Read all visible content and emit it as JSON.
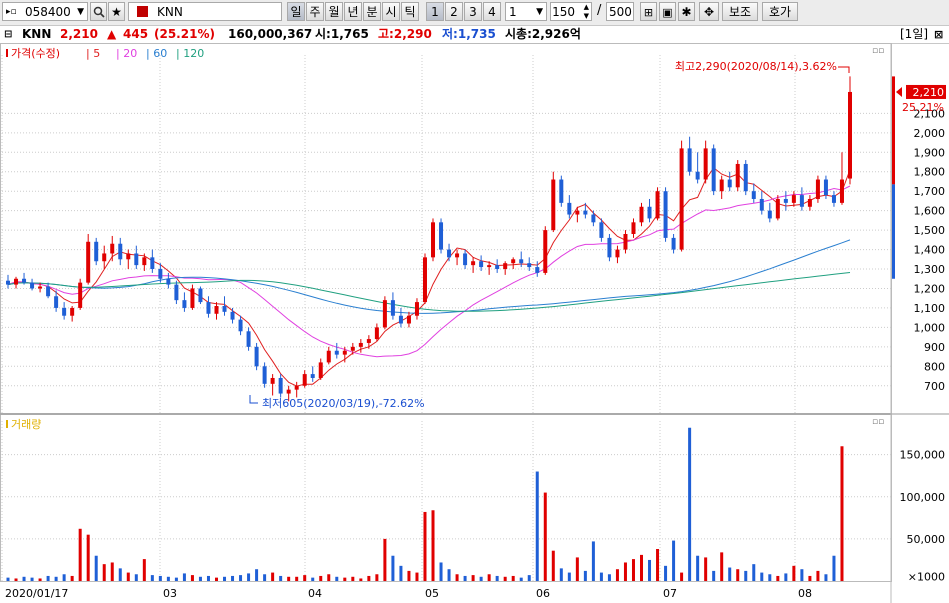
{
  "toolbar": {
    "code": "058400",
    "name": "KNN",
    "periods": [
      "일",
      "주",
      "월",
      "년",
      "분",
      "시",
      "틱"
    ],
    "numbers": [
      "1",
      "2",
      "3",
      "4"
    ],
    "unit_value": "1",
    "count_value": "150",
    "slash": "/",
    "total_value": "500",
    "aux_button": "보조",
    "quote_button": "호가"
  },
  "info": {
    "name": "KNN",
    "price": "2,210",
    "change_arrow": "▲",
    "change": "445",
    "change_pct": "(25.21%)",
    "volume": "160,000,367",
    "open": "시:1,765",
    "high": "고:2,290",
    "low": "저:1,735",
    "market_cap": "시총:2,926억",
    "period_label": "[1일]"
  },
  "colors": {
    "up": "#e00000",
    "down": "#1f5fd6",
    "ma5": "#e02020",
    "ma20": "#e040e0",
    "ma60": "#2a7fd0",
    "ma120": "#20a080"
  },
  "chart_data": {
    "type": "candlestick",
    "legend": {
      "price": "가격(수정)",
      "ma": [
        "5",
        "20",
        "60",
        "120"
      ]
    },
    "volume_label": "거래량",
    "x_ticks": [
      "2020/01/17",
      "03",
      "04",
      "05",
      "06",
      "07",
      "08"
    ],
    "y_ticks": [
      700,
      800,
      900,
      1000,
      1100,
      1200,
      1300,
      1400,
      1500,
      1600,
      1700,
      1800,
      1900,
      2000,
      2100
    ],
    "volume_ticks": [
      "150,000",
      "100,000",
      "50,000"
    ],
    "volume_unit": "×1000",
    "price_range": [
      560,
      2400
    ],
    "volume_range": [
      0,
      190000
    ],
    "last_price_label": "2,210",
    "last_pct_label": "25.21%",
    "high_annotation": "최고2,290(2020/08/14),3.62%",
    "low_annotation": "최저605(2020/03/19),-72.62%",
    "candles": [
      [
        1240,
        1270,
        1200,
        1220
      ],
      [
        1220,
        1260,
        1200,
        1250
      ],
      [
        1250,
        1280,
        1220,
        1230
      ],
      [
        1230,
        1250,
        1190,
        1200
      ],
      [
        1200,
        1230,
        1180,
        1210
      ],
      [
        1210,
        1230,
        1150,
        1160
      ],
      [
        1160,
        1190,
        1080,
        1100
      ],
      [
        1100,
        1130,
        1040,
        1060
      ],
      [
        1060,
        1110,
        1030,
        1100
      ],
      [
        1100,
        1250,
        1090,
        1230
      ],
      [
        1230,
        1480,
        1220,
        1440
      ],
      [
        1440,
        1460,
        1320,
        1340
      ],
      [
        1340,
        1420,
        1300,
        1380
      ],
      [
        1380,
        1470,
        1340,
        1430
      ],
      [
        1430,
        1460,
        1320,
        1350
      ],
      [
        1350,
        1400,
        1300,
        1380
      ],
      [
        1380,
        1420,
        1300,
        1320
      ],
      [
        1320,
        1380,
        1290,
        1360
      ],
      [
        1360,
        1400,
        1280,
        1300
      ],
      [
        1300,
        1330,
        1230,
        1250
      ],
      [
        1250,
        1280,
        1200,
        1220
      ],
      [
        1220,
        1240,
        1120,
        1140
      ],
      [
        1140,
        1180,
        1080,
        1100
      ],
      [
        1100,
        1220,
        1090,
        1200
      ],
      [
        1200,
        1210,
        1120,
        1130
      ],
      [
        1130,
        1160,
        1050,
        1070
      ],
      [
        1070,
        1130,
        1040,
        1110
      ],
      [
        1110,
        1160,
        1060,
        1080
      ],
      [
        1080,
        1100,
        1020,
        1040
      ],
      [
        1040,
        1060,
        960,
        980
      ],
      [
        980,
        1000,
        880,
        900
      ],
      [
        900,
        920,
        780,
        800
      ],
      [
        800,
        820,
        690,
        710
      ],
      [
        710,
        760,
        650,
        740
      ],
      [
        740,
        760,
        640,
        660
      ],
      [
        660,
        700,
        620,
        680
      ],
      [
        680,
        720,
        640,
        700
      ],
      [
        700,
        780,
        690,
        760
      ],
      [
        760,
        800,
        720,
        740
      ],
      [
        740,
        840,
        730,
        820
      ],
      [
        820,
        900,
        810,
        880
      ],
      [
        880,
        920,
        840,
        860
      ],
      [
        860,
        900,
        820,
        880
      ],
      [
        880,
        920,
        860,
        900
      ],
      [
        900,
        940,
        870,
        920
      ],
      [
        920,
        960,
        890,
        940
      ],
      [
        940,
        1020,
        930,
        1000
      ],
      [
        1000,
        1160,
        990,
        1140
      ],
      [
        1140,
        1180,
        1040,
        1060
      ],
      [
        1060,
        1100,
        1000,
        1020
      ],
      [
        1020,
        1080,
        1000,
        1060
      ],
      [
        1060,
        1150,
        1040,
        1130
      ],
      [
        1130,
        1380,
        1120,
        1360
      ],
      [
        1360,
        1560,
        1340,
        1540
      ],
      [
        1540,
        1560,
        1380,
        1400
      ],
      [
        1400,
        1430,
        1340,
        1360
      ],
      [
        1360,
        1400,
        1320,
        1380
      ],
      [
        1380,
        1400,
        1300,
        1320
      ],
      [
        1320,
        1360,
        1280,
        1340
      ],
      [
        1340,
        1370,
        1290,
        1310
      ],
      [
        1310,
        1340,
        1270,
        1320
      ],
      [
        1320,
        1350,
        1280,
        1300
      ],
      [
        1300,
        1340,
        1270,
        1330
      ],
      [
        1330,
        1360,
        1300,
        1350
      ],
      [
        1350,
        1390,
        1310,
        1330
      ],
      [
        1330,
        1360,
        1290,
        1310
      ],
      [
        1310,
        1340,
        1260,
        1280
      ],
      [
        1280,
        1520,
        1270,
        1500
      ],
      [
        1500,
        1800,
        1490,
        1760
      ],
      [
        1760,
        1780,
        1620,
        1640
      ],
      [
        1640,
        1680,
        1560,
        1580
      ],
      [
        1580,
        1620,
        1540,
        1600
      ],
      [
        1600,
        1640,
        1560,
        1580
      ],
      [
        1580,
        1600,
        1520,
        1540
      ],
      [
        1540,
        1560,
        1440,
        1460
      ],
      [
        1460,
        1480,
        1340,
        1360
      ],
      [
        1360,
        1420,
        1330,
        1400
      ],
      [
        1400,
        1500,
        1380,
        1480
      ],
      [
        1480,
        1560,
        1460,
        1540
      ],
      [
        1540,
        1640,
        1520,
        1620
      ],
      [
        1620,
        1660,
        1540,
        1560
      ],
      [
        1560,
        1720,
        1550,
        1700
      ],
      [
        1700,
        1720,
        1440,
        1460
      ],
      [
        1460,
        1480,
        1380,
        1400
      ],
      [
        1400,
        1960,
        1390,
        1920
      ],
      [
        1920,
        1980,
        1780,
        1800
      ],
      [
        1800,
        1900,
        1740,
        1760
      ],
      [
        1760,
        1960,
        1740,
        1920
      ],
      [
        1920,
        1940,
        1680,
        1700
      ],
      [
        1700,
        1780,
        1660,
        1760
      ],
      [
        1760,
        1800,
        1700,
        1720
      ],
      [
        1720,
        1860,
        1700,
        1840
      ],
      [
        1840,
        1860,
        1680,
        1700
      ],
      [
        1700,
        1740,
        1640,
        1660
      ],
      [
        1660,
        1700,
        1580,
        1600
      ],
      [
        1600,
        1640,
        1540,
        1560
      ],
      [
        1560,
        1680,
        1550,
        1660
      ],
      [
        1660,
        1700,
        1600,
        1640
      ],
      [
        1640,
        1700,
        1620,
        1680
      ],
      [
        1680,
        1720,
        1600,
        1620
      ],
      [
        1620,
        1680,
        1600,
        1660
      ],
      [
        1660,
        1780,
        1640,
        1760
      ],
      [
        1760,
        1780,
        1660,
        1680
      ],
      [
        1680,
        1700,
        1620,
        1640
      ],
      [
        1640,
        1900,
        1630,
        1760
      ],
      [
        1765,
        2290,
        1735,
        2210
      ]
    ],
    "volumes": [
      4000,
      3000,
      5000,
      4000,
      3000,
      6000,
      5000,
      8000,
      6000,
      62000,
      55000,
      30000,
      20000,
      22000,
      15000,
      10000,
      8000,
      26000,
      7000,
      6000,
      5000,
      4000,
      9000,
      7000,
      5000,
      6000,
      4000,
      5000,
      6000,
      7000,
      9000,
      14000,
      8000,
      10000,
      6000,
      5000,
      5000,
      7000,
      4000,
      6000,
      8000,
      5000,
      4000,
      5000,
      3000,
      6000,
      8000,
      50000,
      30000,
      18000,
      12000,
      10000,
      82000,
      84000,
      22000,
      14000,
      8000,
      6000,
      7000,
      5000,
      8000,
      6000,
      5000,
      6000,
      4000,
      7000,
      130000,
      105000,
      36000,
      15000,
      10000,
      28000,
      12000,
      47000,
      10000,
      8000,
      14000,
      22000,
      26000,
      31000,
      25000,
      38000,
      18000,
      48000,
      10000,
      182000,
      30000,
      28000,
      12000,
      34000,
      16000,
      14000,
      12000,
      20000,
      10000,
      8000,
      6000,
      9000,
      18000,
      14000,
      6000,
      12000,
      8000,
      30000,
      160000
    ]
  }
}
